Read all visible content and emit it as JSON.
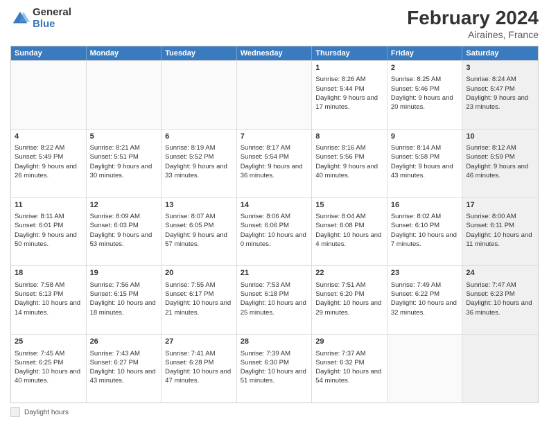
{
  "logo": {
    "general": "General",
    "blue": "Blue"
  },
  "header": {
    "title": "February 2024",
    "subtitle": "Airaines, France"
  },
  "legend": {
    "box_label": "Daylight hours"
  },
  "weekdays": [
    "Sunday",
    "Monday",
    "Tuesday",
    "Wednesday",
    "Thursday",
    "Friday",
    "Saturday"
  ],
  "rows": [
    [
      {
        "day": "",
        "content": "",
        "empty": true
      },
      {
        "day": "",
        "content": "",
        "empty": true
      },
      {
        "day": "",
        "content": "",
        "empty": true
      },
      {
        "day": "",
        "content": "",
        "empty": true
      },
      {
        "day": "1",
        "content": "Sunrise: 8:26 AM\nSunset: 5:44 PM\nDaylight: 9 hours and 17 minutes.",
        "empty": false
      },
      {
        "day": "2",
        "content": "Sunrise: 8:25 AM\nSunset: 5:46 PM\nDaylight: 9 hours and 20 minutes.",
        "empty": false
      },
      {
        "day": "3",
        "content": "Sunrise: 8:24 AM\nSunset: 5:47 PM\nDaylight: 9 hours and 23 minutes.",
        "empty": false,
        "shaded": true
      }
    ],
    [
      {
        "day": "4",
        "content": "Sunrise: 8:22 AM\nSunset: 5:49 PM\nDaylight: 9 hours and 26 minutes.",
        "empty": false
      },
      {
        "day": "5",
        "content": "Sunrise: 8:21 AM\nSunset: 5:51 PM\nDaylight: 9 hours and 30 minutes.",
        "empty": false
      },
      {
        "day": "6",
        "content": "Sunrise: 8:19 AM\nSunset: 5:52 PM\nDaylight: 9 hours and 33 minutes.",
        "empty": false
      },
      {
        "day": "7",
        "content": "Sunrise: 8:17 AM\nSunset: 5:54 PM\nDaylight: 9 hours and 36 minutes.",
        "empty": false
      },
      {
        "day": "8",
        "content": "Sunrise: 8:16 AM\nSunset: 5:56 PM\nDaylight: 9 hours and 40 minutes.",
        "empty": false
      },
      {
        "day": "9",
        "content": "Sunrise: 8:14 AM\nSunset: 5:58 PM\nDaylight: 9 hours and 43 minutes.",
        "empty": false
      },
      {
        "day": "10",
        "content": "Sunrise: 8:12 AM\nSunset: 5:59 PM\nDaylight: 9 hours and 46 minutes.",
        "empty": false,
        "shaded": true
      }
    ],
    [
      {
        "day": "11",
        "content": "Sunrise: 8:11 AM\nSunset: 6:01 PM\nDaylight: 9 hours and 50 minutes.",
        "empty": false
      },
      {
        "day": "12",
        "content": "Sunrise: 8:09 AM\nSunset: 6:03 PM\nDaylight: 9 hours and 53 minutes.",
        "empty": false
      },
      {
        "day": "13",
        "content": "Sunrise: 8:07 AM\nSunset: 6:05 PM\nDaylight: 9 hours and 57 minutes.",
        "empty": false
      },
      {
        "day": "14",
        "content": "Sunrise: 8:06 AM\nSunset: 6:06 PM\nDaylight: 10 hours and 0 minutes.",
        "empty": false
      },
      {
        "day": "15",
        "content": "Sunrise: 8:04 AM\nSunset: 6:08 PM\nDaylight: 10 hours and 4 minutes.",
        "empty": false
      },
      {
        "day": "16",
        "content": "Sunrise: 8:02 AM\nSunset: 6:10 PM\nDaylight: 10 hours and 7 minutes.",
        "empty": false
      },
      {
        "day": "17",
        "content": "Sunrise: 8:00 AM\nSunset: 6:11 PM\nDaylight: 10 hours and 11 minutes.",
        "empty": false,
        "shaded": true
      }
    ],
    [
      {
        "day": "18",
        "content": "Sunrise: 7:58 AM\nSunset: 6:13 PM\nDaylight: 10 hours and 14 minutes.",
        "empty": false
      },
      {
        "day": "19",
        "content": "Sunrise: 7:56 AM\nSunset: 6:15 PM\nDaylight: 10 hours and 18 minutes.",
        "empty": false
      },
      {
        "day": "20",
        "content": "Sunrise: 7:55 AM\nSunset: 6:17 PM\nDaylight: 10 hours and 21 minutes.",
        "empty": false
      },
      {
        "day": "21",
        "content": "Sunrise: 7:53 AM\nSunset: 6:18 PM\nDaylight: 10 hours and 25 minutes.",
        "empty": false
      },
      {
        "day": "22",
        "content": "Sunrise: 7:51 AM\nSunset: 6:20 PM\nDaylight: 10 hours and 29 minutes.",
        "empty": false
      },
      {
        "day": "23",
        "content": "Sunrise: 7:49 AM\nSunset: 6:22 PM\nDaylight: 10 hours and 32 minutes.",
        "empty": false
      },
      {
        "day": "24",
        "content": "Sunrise: 7:47 AM\nSunset: 6:23 PM\nDaylight: 10 hours and 36 minutes.",
        "empty": false,
        "shaded": true
      }
    ],
    [
      {
        "day": "25",
        "content": "Sunrise: 7:45 AM\nSunset: 6:25 PM\nDaylight: 10 hours and 40 minutes.",
        "empty": false
      },
      {
        "day": "26",
        "content": "Sunrise: 7:43 AM\nSunset: 6:27 PM\nDaylight: 10 hours and 43 minutes.",
        "empty": false
      },
      {
        "day": "27",
        "content": "Sunrise: 7:41 AM\nSunset: 6:28 PM\nDaylight: 10 hours and 47 minutes.",
        "empty": false
      },
      {
        "day": "28",
        "content": "Sunrise: 7:39 AM\nSunset: 6:30 PM\nDaylight: 10 hours and 51 minutes.",
        "empty": false
      },
      {
        "day": "29",
        "content": "Sunrise: 7:37 AM\nSunset: 6:32 PM\nDaylight: 10 hours and 54 minutes.",
        "empty": false
      },
      {
        "day": "",
        "content": "",
        "empty": true
      },
      {
        "day": "",
        "content": "",
        "empty": true,
        "shaded": true
      }
    ]
  ]
}
